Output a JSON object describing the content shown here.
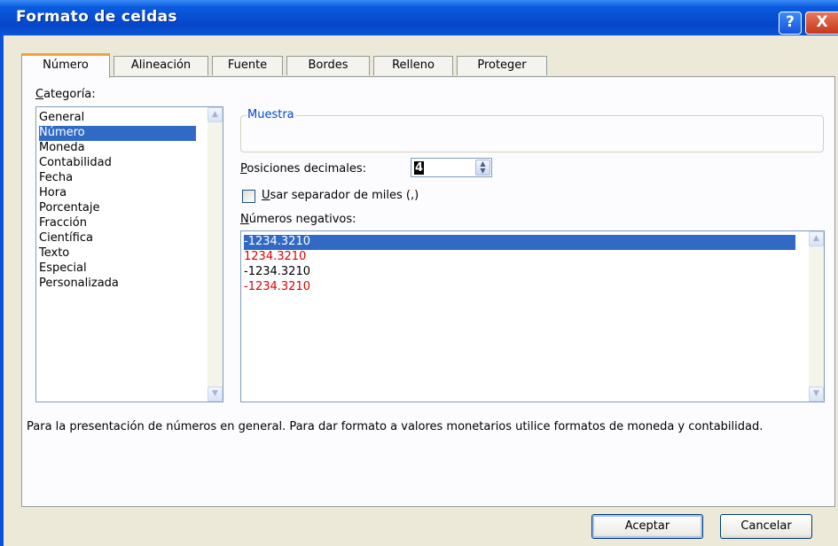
{
  "dialog": {
    "title": "Formato de celdas",
    "help_glyph": "?",
    "close_glyph": "X"
  },
  "tabs": [
    {
      "label": "Número"
    },
    {
      "label": "Alineación"
    },
    {
      "label": "Fuente"
    },
    {
      "label": "Bordes"
    },
    {
      "label": "Relleno"
    },
    {
      "label": "Proteger"
    }
  ],
  "category": {
    "label_key": "C",
    "label_rest": "ategoría:",
    "items": [
      "General",
      "Número",
      "Moneda",
      "Contabilidad",
      "Fecha",
      "Hora",
      "Porcentaje",
      "Fracción",
      "Científica",
      "Texto",
      "Especial",
      "Personalizada"
    ],
    "selected": "Número"
  },
  "sample": {
    "label": "Muestra",
    "value": ""
  },
  "decimals": {
    "label_key": "P",
    "label_rest": "osiciones decimales:",
    "value": "4"
  },
  "thousands": {
    "label_key": "U",
    "label_rest": "sar separador de miles (,)",
    "checked": false
  },
  "negative": {
    "label_key": "N",
    "label_rest": "úmeros negativos:",
    "items": [
      {
        "text": "-1234.3210",
        "color": "#000000"
      },
      {
        "text": "1234.3210",
        "color": "#e00000"
      },
      {
        "text": "-1234.3210",
        "color": "#000000"
      },
      {
        "text": "-1234.3210",
        "color": "#e00000"
      }
    ],
    "selected_index": 0
  },
  "description": "Para la presentación de números en general. Para dar formato a valores monetarios utilice formatos de moneda y contabilidad.",
  "buttons": {
    "ok": "Aceptar",
    "cancel": "Cancelar"
  },
  "colors": {
    "titlebar": "#0a54d6",
    "dialog_face": "#ece9d8",
    "selection": "#316ac5",
    "negative_red": "#e00000"
  }
}
